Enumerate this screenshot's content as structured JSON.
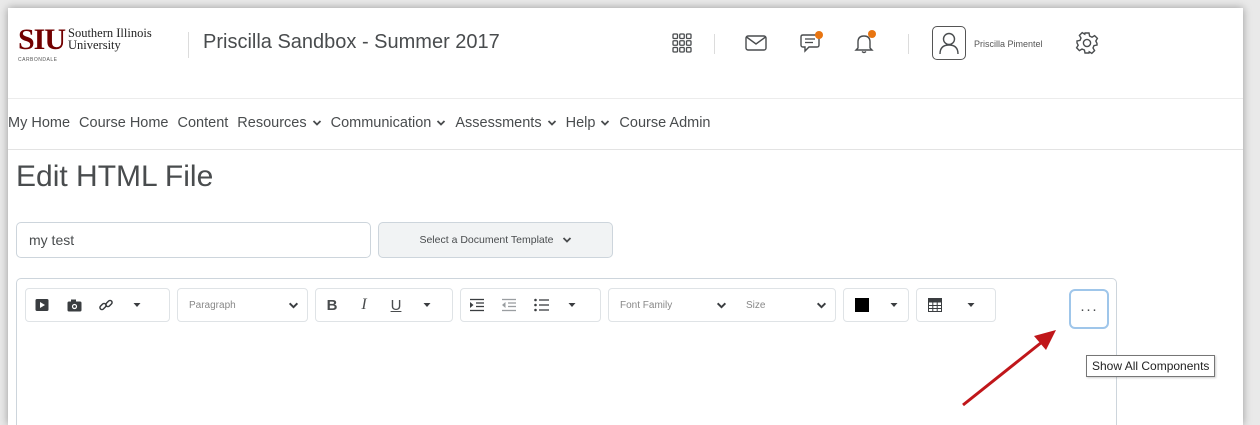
{
  "logo": {
    "abbr": "SIU",
    "name_line1": "Southern Illinois",
    "name_line2": "University",
    "sub": "CARBONDALE"
  },
  "header": {
    "course_title": "Priscilla Sandbox - Summer 2017",
    "user_name": "Priscilla Pimentel",
    "icons": [
      "apps-grid-icon",
      "mail-icon",
      "chat-icon",
      "bell-icon",
      "avatar-icon",
      "gear-icon"
    ],
    "badge_color": "#e87511"
  },
  "nav": {
    "items": [
      {
        "label": "My Home"
      },
      {
        "label": "Course Home"
      },
      {
        "label": "Content"
      },
      {
        "label": "Resources"
      },
      {
        "label": "Communication"
      },
      {
        "label": "Assessments"
      },
      {
        "label": "Help"
      },
      {
        "label": "Course Admin"
      }
    ]
  },
  "page": {
    "title": "Edit HTML File",
    "file_title_value": "my test",
    "template_label": "Select a Document Template"
  },
  "toolbar": {
    "paragraph_label": "Paragraph",
    "font_family_label": "Font Family",
    "size_label": "Size",
    "bold": "B",
    "italic": "I",
    "underline": "U",
    "more_label": "···",
    "color_swatch": "#000000"
  },
  "tooltip": {
    "text": "Show All Components"
  },
  "annotation": {
    "arrow_color": "#c0161a"
  }
}
